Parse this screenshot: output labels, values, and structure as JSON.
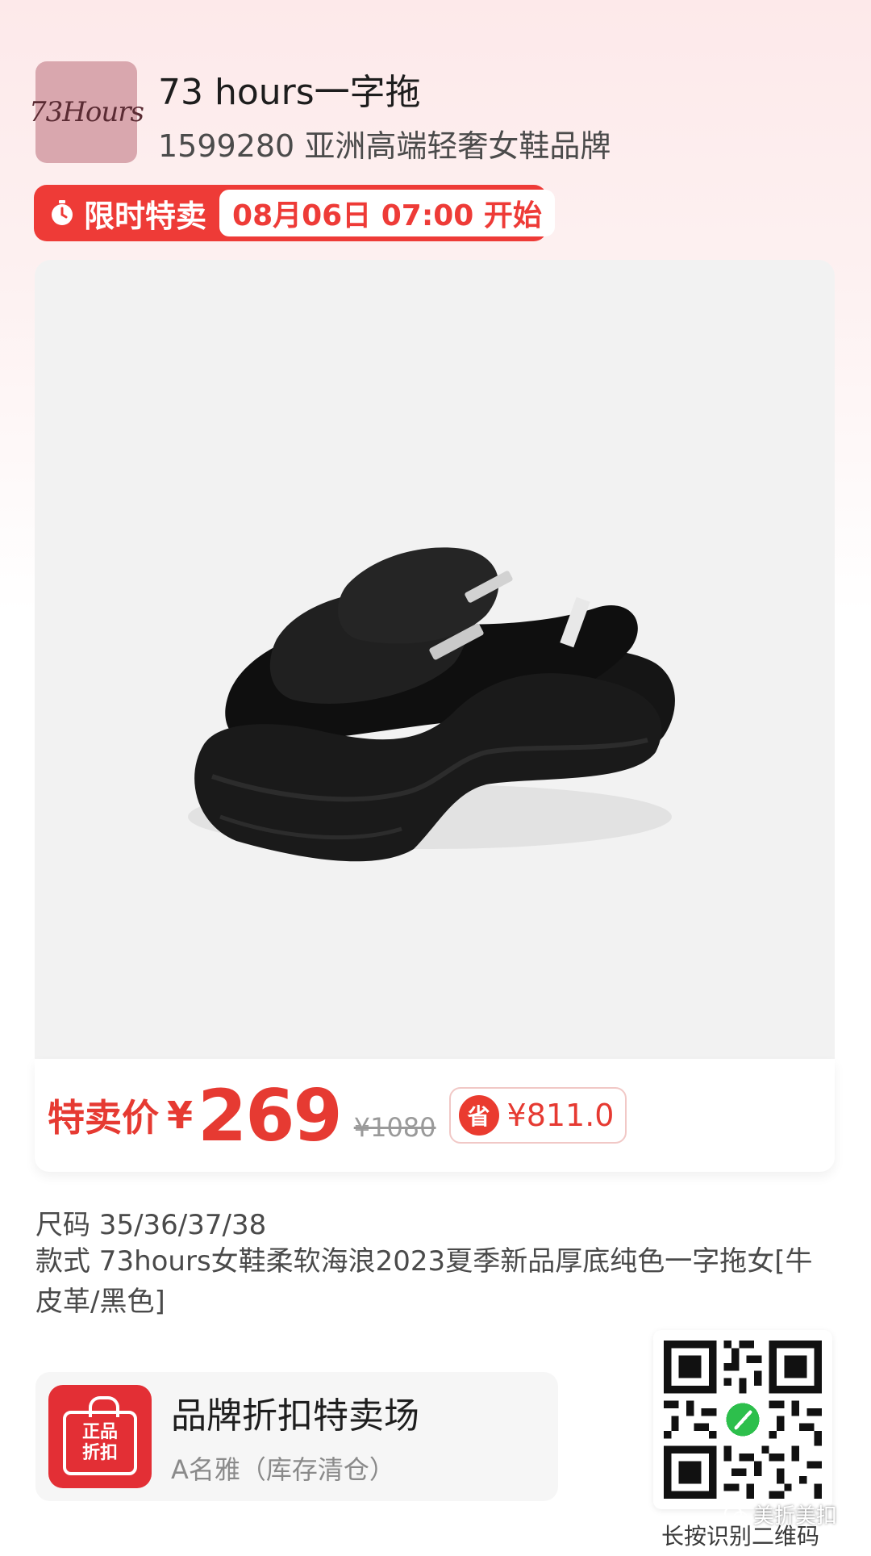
{
  "header": {
    "logo_text": "73Hours",
    "title": "73 hours一字拖",
    "subtitle": "1599280 亚洲高端轻奢女鞋品牌"
  },
  "flash_sale": {
    "label": "限时特卖",
    "time": "08月06日 07:00 开始",
    "icon": "stopwatch-icon"
  },
  "product": {
    "image_desc_icon": "sandal-image"
  },
  "price": {
    "label": "特卖价",
    "currency": "¥",
    "value": "269",
    "original": "¥1080",
    "save_badge": "省",
    "save_amount": "¥811.0"
  },
  "details": {
    "size": "尺码 35/36/37/38",
    "style": "款式 73hours女鞋柔软海浪2023夏季新品厚底纯色一字拖女[牛皮革/黑色]"
  },
  "store": {
    "icon_line1": "正品",
    "icon_line2": "折扣",
    "title": "品牌折扣特卖场",
    "subtitle": "A名雅（库存清仓）"
  },
  "qr": {
    "caption": "长按识别二维码"
  },
  "watermark": {
    "text": "美折美扣"
  },
  "colors": {
    "accent_red": "#ee3b37",
    "price_red": "#e63a32",
    "logo_bg": "#d9a7ae"
  }
}
